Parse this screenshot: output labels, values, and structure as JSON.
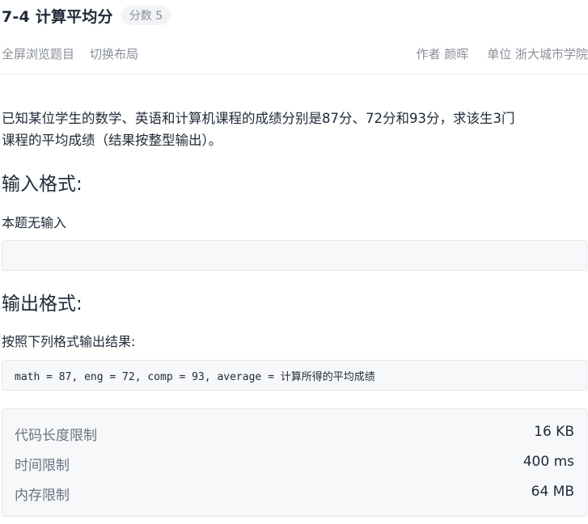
{
  "header": {
    "title": "7-4 计算平均分",
    "score_badge": "分数 5"
  },
  "toolbar": {
    "fullscreen_label": "全屏浏览题目",
    "switch_layout_label": "切换布局",
    "author_label": "作者 颜晖",
    "unit_label": "单位 浙大城市学院"
  },
  "problem": {
    "description_line1": "已知某位学生的数学、英语和计算机课程的成绩分别是87分、72分和93分，求该生3门",
    "description_line2": "课程的平均成绩（结果按整型输出）。",
    "input_heading": "输入格式:",
    "input_text": "本题无输入",
    "input_sample": "",
    "output_heading": "输出格式:",
    "output_text": "按照下列格式输出结果:",
    "output_sample": "math = 87, eng = 72, comp = 93, average = 计算所得的平均成绩"
  },
  "limits": [
    {
      "label": "代码长度限制",
      "value": "16 KB"
    },
    {
      "label": "时间限制",
      "value": "400 ms"
    },
    {
      "label": "内存限制",
      "value": "64 MB"
    }
  ]
}
